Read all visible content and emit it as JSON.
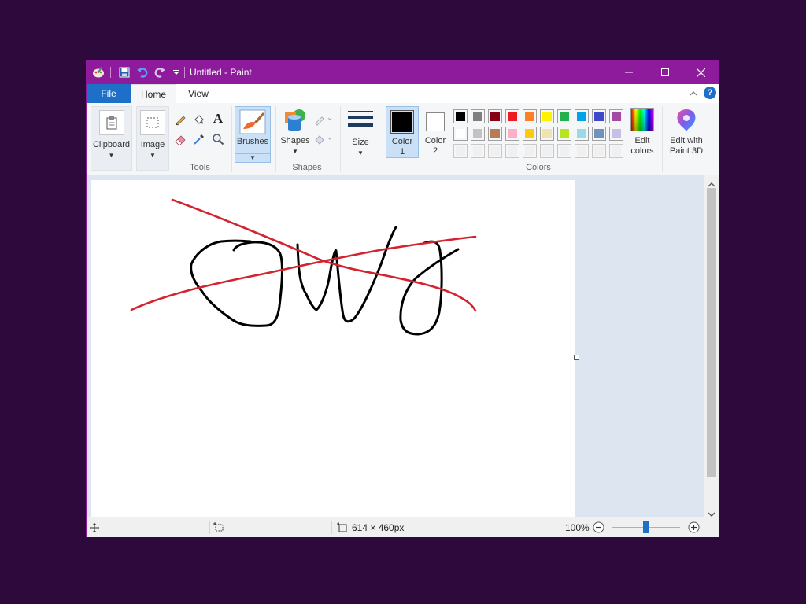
{
  "window": {
    "title": "Untitled - Paint",
    "controls": {
      "minimize": "minimize-icon",
      "maximize": "maximize-icon",
      "close": "close-icon"
    }
  },
  "tabs": [
    {
      "label": "File"
    },
    {
      "label": "Home"
    },
    {
      "label": "View"
    }
  ],
  "ribbon": {
    "clipboard": {
      "label": "Clipboard"
    },
    "image": {
      "label": "Image"
    },
    "tools_group": {
      "label": "Tools"
    },
    "brushes": {
      "label": "Brushes"
    },
    "shapes": {
      "label": "Shapes"
    },
    "shapes_group": {
      "label": "Shapes"
    },
    "size": {
      "label": "Size"
    },
    "color1": {
      "label_line1": "Color",
      "label_line2": "1",
      "color": "#000000"
    },
    "color2": {
      "label_line1": "Color",
      "label_line2": "2",
      "color": "#ffffff"
    },
    "colors_group": {
      "label": "Colors"
    },
    "edit_colors": {
      "label_line1": "Edit",
      "label_line2": "colors"
    },
    "paint3d": {
      "label_line1": "Edit with",
      "label_line2": "Paint 3D"
    }
  },
  "palette": {
    "row1": [
      "#000000",
      "#7f7f7f",
      "#880015",
      "#ed1c24",
      "#ff7f27",
      "#fff200",
      "#22b14c",
      "#00a2e8",
      "#3f48cc",
      "#a349a4"
    ],
    "row2": [
      "#ffffff",
      "#c3c3c3",
      "#b97a57",
      "#ffaec9",
      "#ffc90e",
      "#efe4b0",
      "#b5e61d",
      "#99d9ea",
      "#7092be",
      "#c8bfe7"
    ],
    "row3": [
      "#f0f0f0",
      "#f0f0f0",
      "#f0f0f0",
      "#f0f0f0",
      "#f0f0f0",
      "#f0f0f0",
      "#f0f0f0",
      "#f0f0f0",
      "#f0f0f0",
      "#f0f0f0"
    ]
  },
  "status": {
    "image_size": "614 × 460px",
    "zoom": "100%",
    "zoom_level_fraction": 0.5
  },
  "colors": {
    "titlebar": "#8d1b9c",
    "file_tab": "#1e6fc8",
    "stroke_black": "#000000",
    "stroke_red": "#d3232e"
  }
}
